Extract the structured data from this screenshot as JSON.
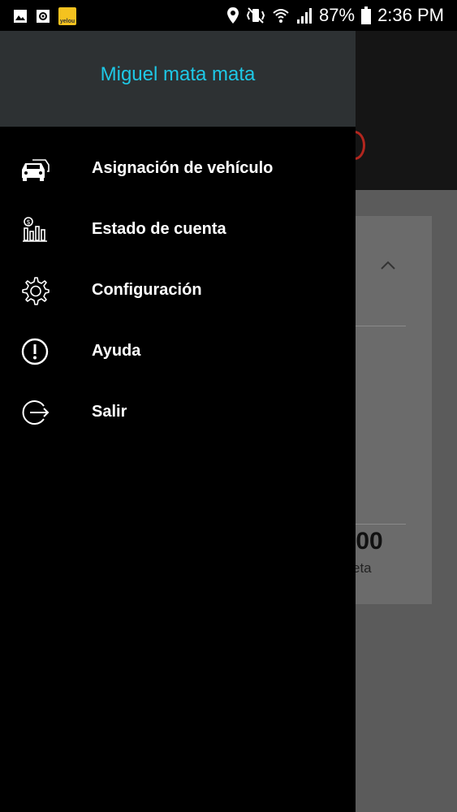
{
  "status_bar": {
    "battery": "87%",
    "time": "2:36 PM",
    "app_badge": "yelou"
  },
  "drawer": {
    "user_name": "Miguel mata mata",
    "menu": [
      {
        "label": "Asignación de vehículo",
        "icon": "car-icon"
      },
      {
        "label": "Estado de cuenta",
        "icon": "chart-icon"
      },
      {
        "label": "Configuración",
        "icon": "gear-icon"
      },
      {
        "label": "Ayuda",
        "icon": "alert-icon"
      },
      {
        "label": "Salir",
        "icon": "logout-icon"
      }
    ]
  },
  "background": {
    "amount_partial": ".00",
    "label_partial": "eta"
  },
  "colors": {
    "accent": "#1ec8e6",
    "drawer_header": "#2d3133",
    "drawer_bg": "#000000"
  }
}
